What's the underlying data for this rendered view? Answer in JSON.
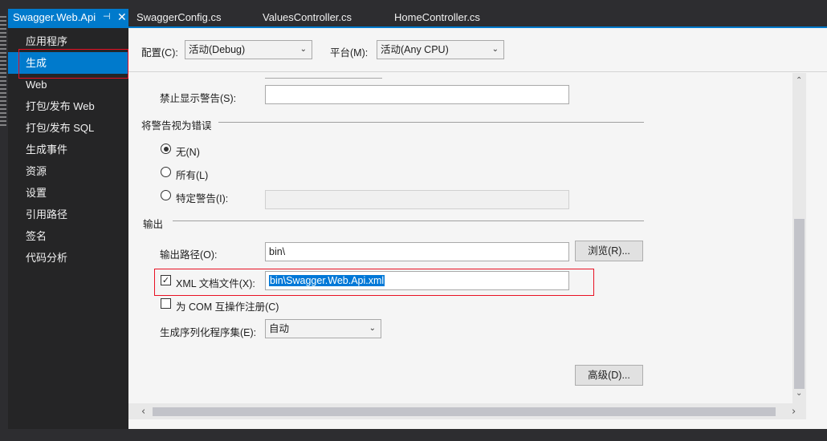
{
  "tabs": [
    {
      "label": "Swagger.Web.Api",
      "pin": "⊣",
      "close": "✕",
      "active": true
    },
    {
      "label": "SwaggerConfig.cs",
      "active": false
    },
    {
      "label": "ValuesController.cs",
      "active": false
    },
    {
      "label": "HomeController.cs",
      "active": false
    }
  ],
  "sidebar": {
    "items": [
      {
        "label": "应用程序"
      },
      {
        "label": "生成",
        "selected": true
      },
      {
        "label": "Web"
      },
      {
        "label": "打包/发布 Web"
      },
      {
        "label": "打包/发布 SQL"
      },
      {
        "label": "生成事件"
      },
      {
        "label": "资源"
      },
      {
        "label": "设置"
      },
      {
        "label": "引用路径"
      },
      {
        "label": "签名"
      },
      {
        "label": "代码分析"
      }
    ]
  },
  "config": {
    "config_label": "配置(C):",
    "config_value": "活动(Debug)",
    "platform_label": "平台(M):",
    "platform_value": "活动(Any CPU)"
  },
  "form": {
    "suppress_warnings_label": "禁止显示警告(S):",
    "suppress_warnings_value": "",
    "warnings_as_errors_group": "将警告视为错误",
    "radio_none": "无(N)",
    "radio_all": "所有(L)",
    "radio_specific": "特定警告(I):",
    "specific_value": "",
    "output_group": "输出",
    "output_path_label": "输出路径(O):",
    "output_path_value": "bin\\",
    "browse_button": "浏览(R)...",
    "xml_doc_label": "XML 文档文件(X):",
    "xml_doc_value": "bin\\Swagger.Web.Api.xml",
    "xml_doc_checked": true,
    "com_interop_label": "为 COM 互操作注册(C)",
    "com_interop_checked": false,
    "serialization_label": "生成序列化程序集(E):",
    "serialization_value": "自动",
    "advanced_button": "高级(D)..."
  },
  "colors": {
    "accent": "#007acc",
    "highlight_box": "#e81123",
    "sidebar_bg": "#252526",
    "panel_bg": "#f5f5f5"
  },
  "icons": {
    "chevron": "chevron-down-icon",
    "check": "checkmark-icon",
    "scroll_up": "scroll-up-icon",
    "scroll_down": "scroll-down-icon",
    "scroll_left": "scroll-left-icon",
    "scroll_right": "scroll-right-icon"
  }
}
